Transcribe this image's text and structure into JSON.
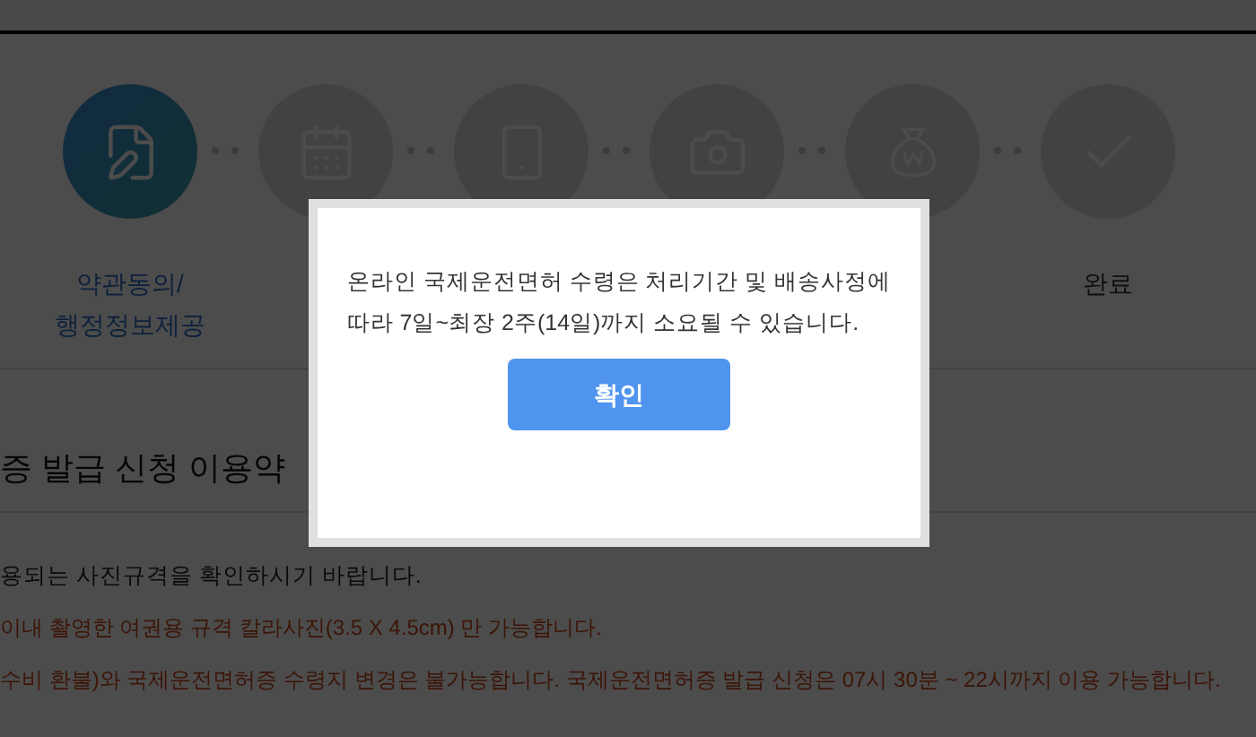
{
  "steps": [
    {
      "kind": "document",
      "selected": true,
      "label": [
        "약관동의/",
        "행정정보제공"
      ]
    },
    {
      "kind": "calendar",
      "selected": false
    },
    {
      "kind": "phone",
      "selected": false
    },
    {
      "kind": "camera",
      "selected": false
    },
    {
      "kind": "moneybag",
      "selected": false
    },
    {
      "kind": "check",
      "selected": false,
      "label": [
        "완료"
      ]
    }
  ],
  "section_title": "증 발급 신청 이용약",
  "notices": [
    {
      "kind": "plain",
      "text": "용되는 사진규격을 확인하시기 바랍니다."
    },
    {
      "kind": "warning",
      "text": "이내 촬영한 여권용 규격 칼라사진(3.5 X 4.5cm) 만 가능합니다."
    },
    {
      "kind": "warning",
      "text": "수비 환불)와 국제운전면허증 수령지 변경은 불가능합니다. 국제운전면허증 발급 신청은 07시 30분 ~ 22시까지 이용 가능합니다."
    }
  ],
  "dialog": {
    "message": "온라인 국제운전면허 수령은 처리기간 및 배송사정에\n따라 7일~최장 2주(14일)까지 소요될 수 있습니다.",
    "button": "확인"
  }
}
